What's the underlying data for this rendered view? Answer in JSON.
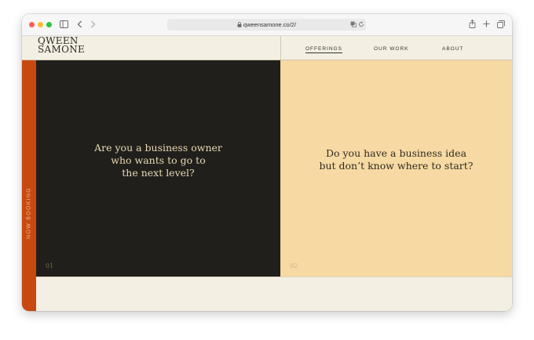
{
  "browser": {
    "url": "qweensamone.co/2/"
  },
  "site": {
    "logo_line1": "QWEEN",
    "logo_line2": "SAMONE",
    "nav": [
      {
        "label": "OFFERINGS"
      },
      {
        "label": "OUR WORK"
      },
      {
        "label": "ABOUT"
      }
    ],
    "sidebar_label": "NOW BOOKING"
  },
  "panels": [
    {
      "lines": [
        "Are you a business owner",
        "who wants to go to",
        "the next level?"
      ],
      "number": "01"
    },
    {
      "lines": [
        "Do you have a business idea",
        "but don’t know where to start?"
      ],
      "number": "02"
    }
  ],
  "colors": {
    "accent_sidebar": "#c8490f",
    "dark_panel": "#201f1b",
    "light_panel": "#f7d9a3",
    "page_bg": "#f3efe2"
  }
}
